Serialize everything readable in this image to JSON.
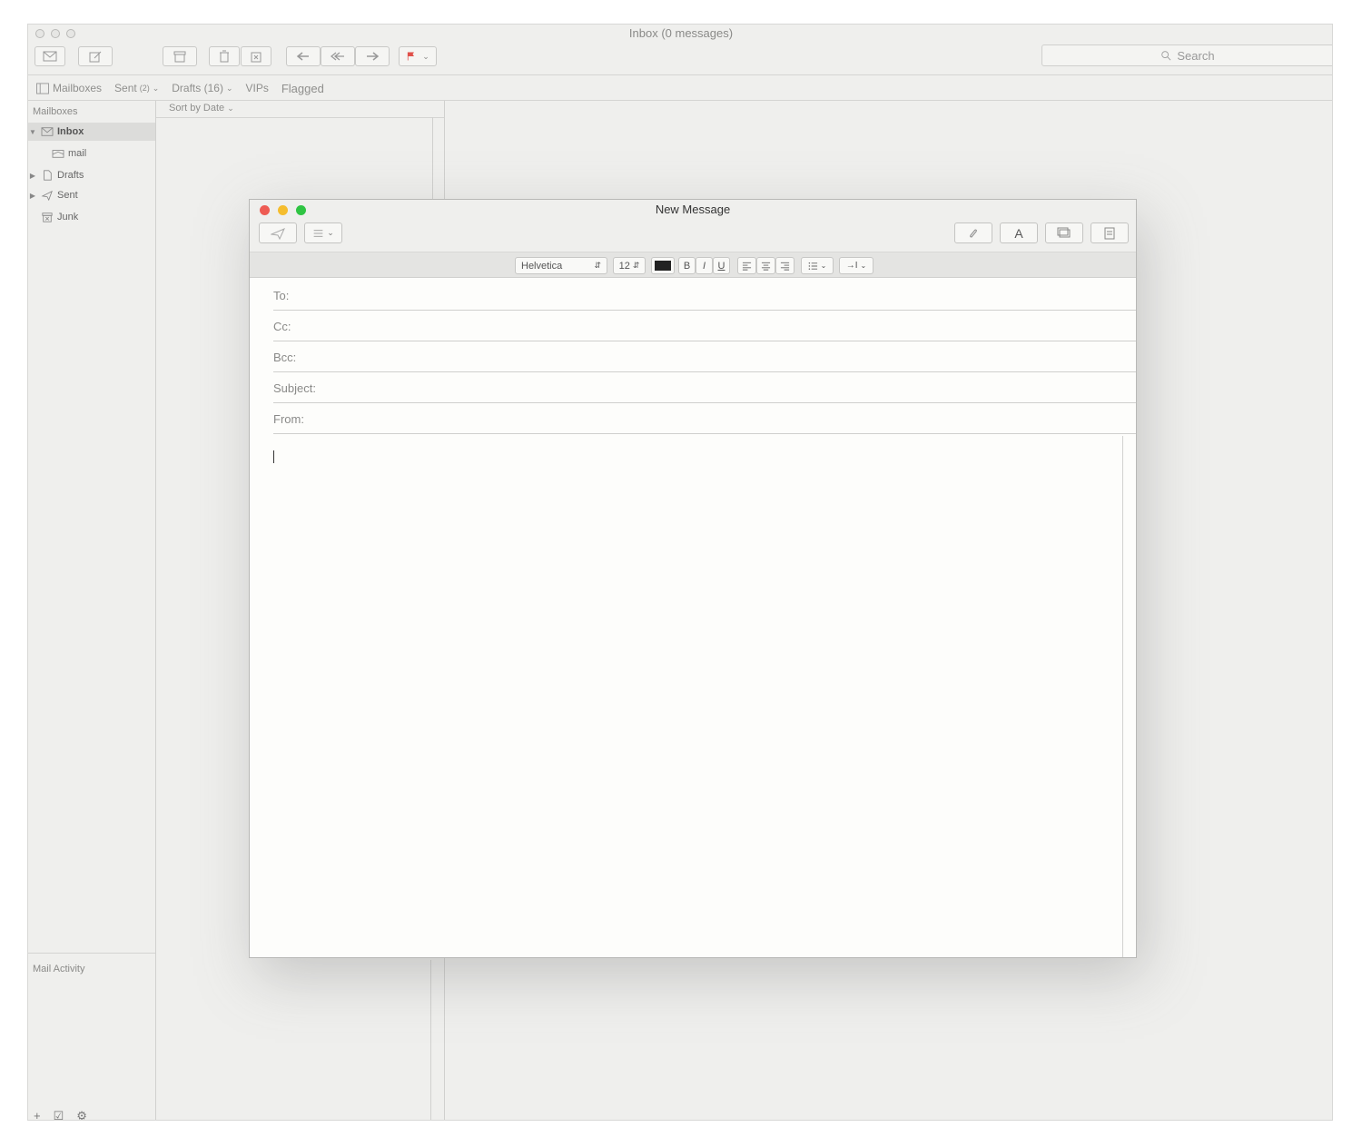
{
  "window": {
    "title": "Inbox (0 messages)"
  },
  "toolbar": {
    "get_mail_icon": "envelope-icon",
    "compose_icon": "compose-icon",
    "archive_icon": "archive-icon",
    "delete_icon": "trash-icon",
    "junk_icon": "junk-icon",
    "reply_icon": "reply-icon",
    "reply_all_icon": "reply-all-icon",
    "forward_icon": "forward-icon",
    "flag_icon": "flag-icon",
    "flag_color": "#e0504a",
    "search_placeholder": "Search"
  },
  "favorites": {
    "mailboxes": "Mailboxes",
    "sent": "Sent",
    "sent_count": "(2)",
    "drafts": "Drafts (16)",
    "vips": "VIPs",
    "flagged": "Flagged"
  },
  "sidebar": {
    "header": "Mailboxes",
    "items": [
      {
        "label": "Inbox",
        "icon": "inbox-icon"
      },
      {
        "label": "mail",
        "icon": "envelope-icon"
      },
      {
        "label": "Drafts",
        "icon": "document-icon"
      },
      {
        "label": "Sent",
        "icon": "paper-plane-icon"
      },
      {
        "label": "Junk",
        "icon": "junk-bin-icon"
      }
    ],
    "activity": "Mail Activity"
  },
  "message_list": {
    "sort_label": "Sort by Date"
  },
  "compose": {
    "title": "New Message",
    "traffic_lights": {
      "close": "#ee5b53",
      "minimize": "#f5bd2e",
      "zoom": "#2fc443"
    },
    "format": {
      "font": "Helvetica",
      "size": "12",
      "bold": "B",
      "italic": "I",
      "underline": "U",
      "indent": "→I"
    },
    "fields": {
      "to": "To:",
      "cc": "Cc:",
      "bcc": "Bcc:",
      "subject": "Subject:",
      "from": "From:"
    },
    "buttons": {
      "font_panel": "A"
    }
  }
}
